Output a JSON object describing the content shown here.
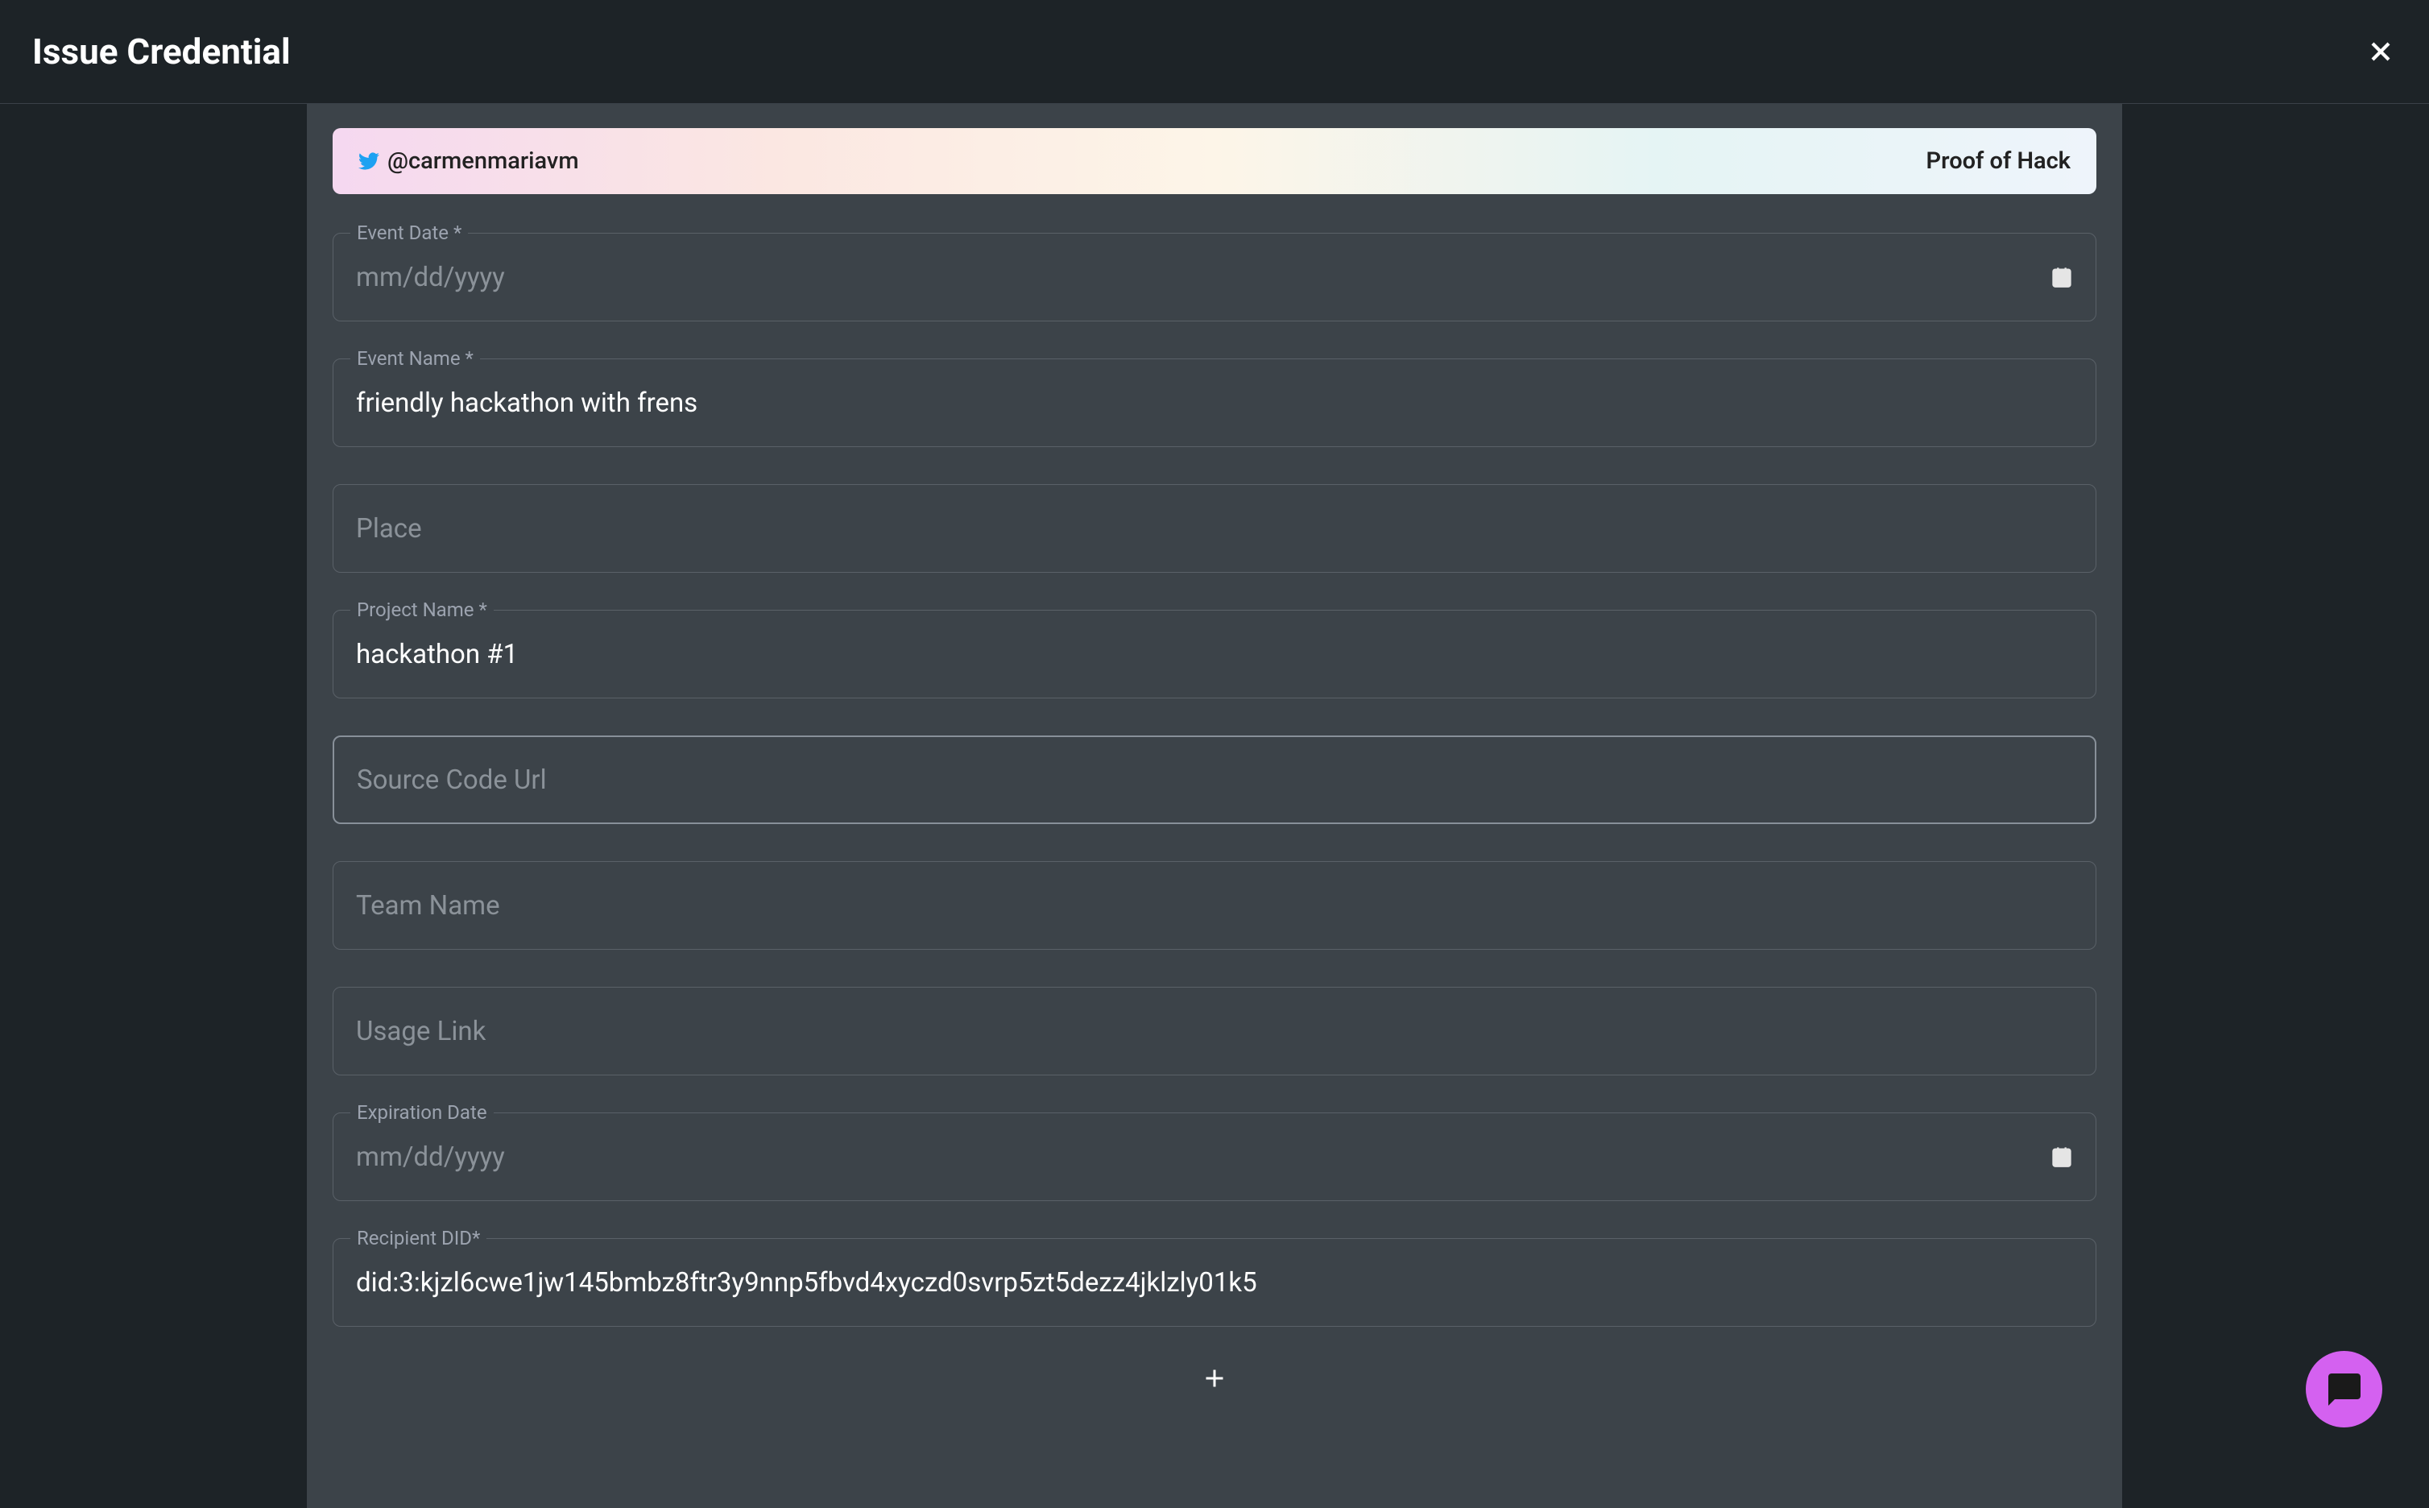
{
  "header": {
    "title": "Issue Credential"
  },
  "badge": {
    "handle": "@carmenmariavm",
    "type": "Proof of Hack"
  },
  "fields": {
    "eventDate": {
      "label": "Event Date",
      "required": "*",
      "placeholder": "mm/dd/yyyy",
      "value": ""
    },
    "eventName": {
      "label": "Event Name",
      "required": "*",
      "value": "friendly hackathon with frens"
    },
    "place": {
      "label": "Place",
      "value": ""
    },
    "projectName": {
      "label": "Project Name",
      "required": "*",
      "value": "hackathon #1"
    },
    "sourceCodeUrl": {
      "label": "Source Code Url",
      "value": ""
    },
    "teamName": {
      "label": "Team Name",
      "value": ""
    },
    "usageLink": {
      "label": "Usage Link",
      "value": ""
    },
    "expirationDate": {
      "label": "Expiration Date",
      "placeholder": "mm/dd/yyyy",
      "value": ""
    },
    "recipientDid": {
      "label": "Recipient DID",
      "required": "*",
      "value": "did:3:kjzl6cwe1jw145bmbz8ftr3y9nnp5fbvd4xyczd0svrp5zt5dezz4jklzly01k5"
    }
  }
}
